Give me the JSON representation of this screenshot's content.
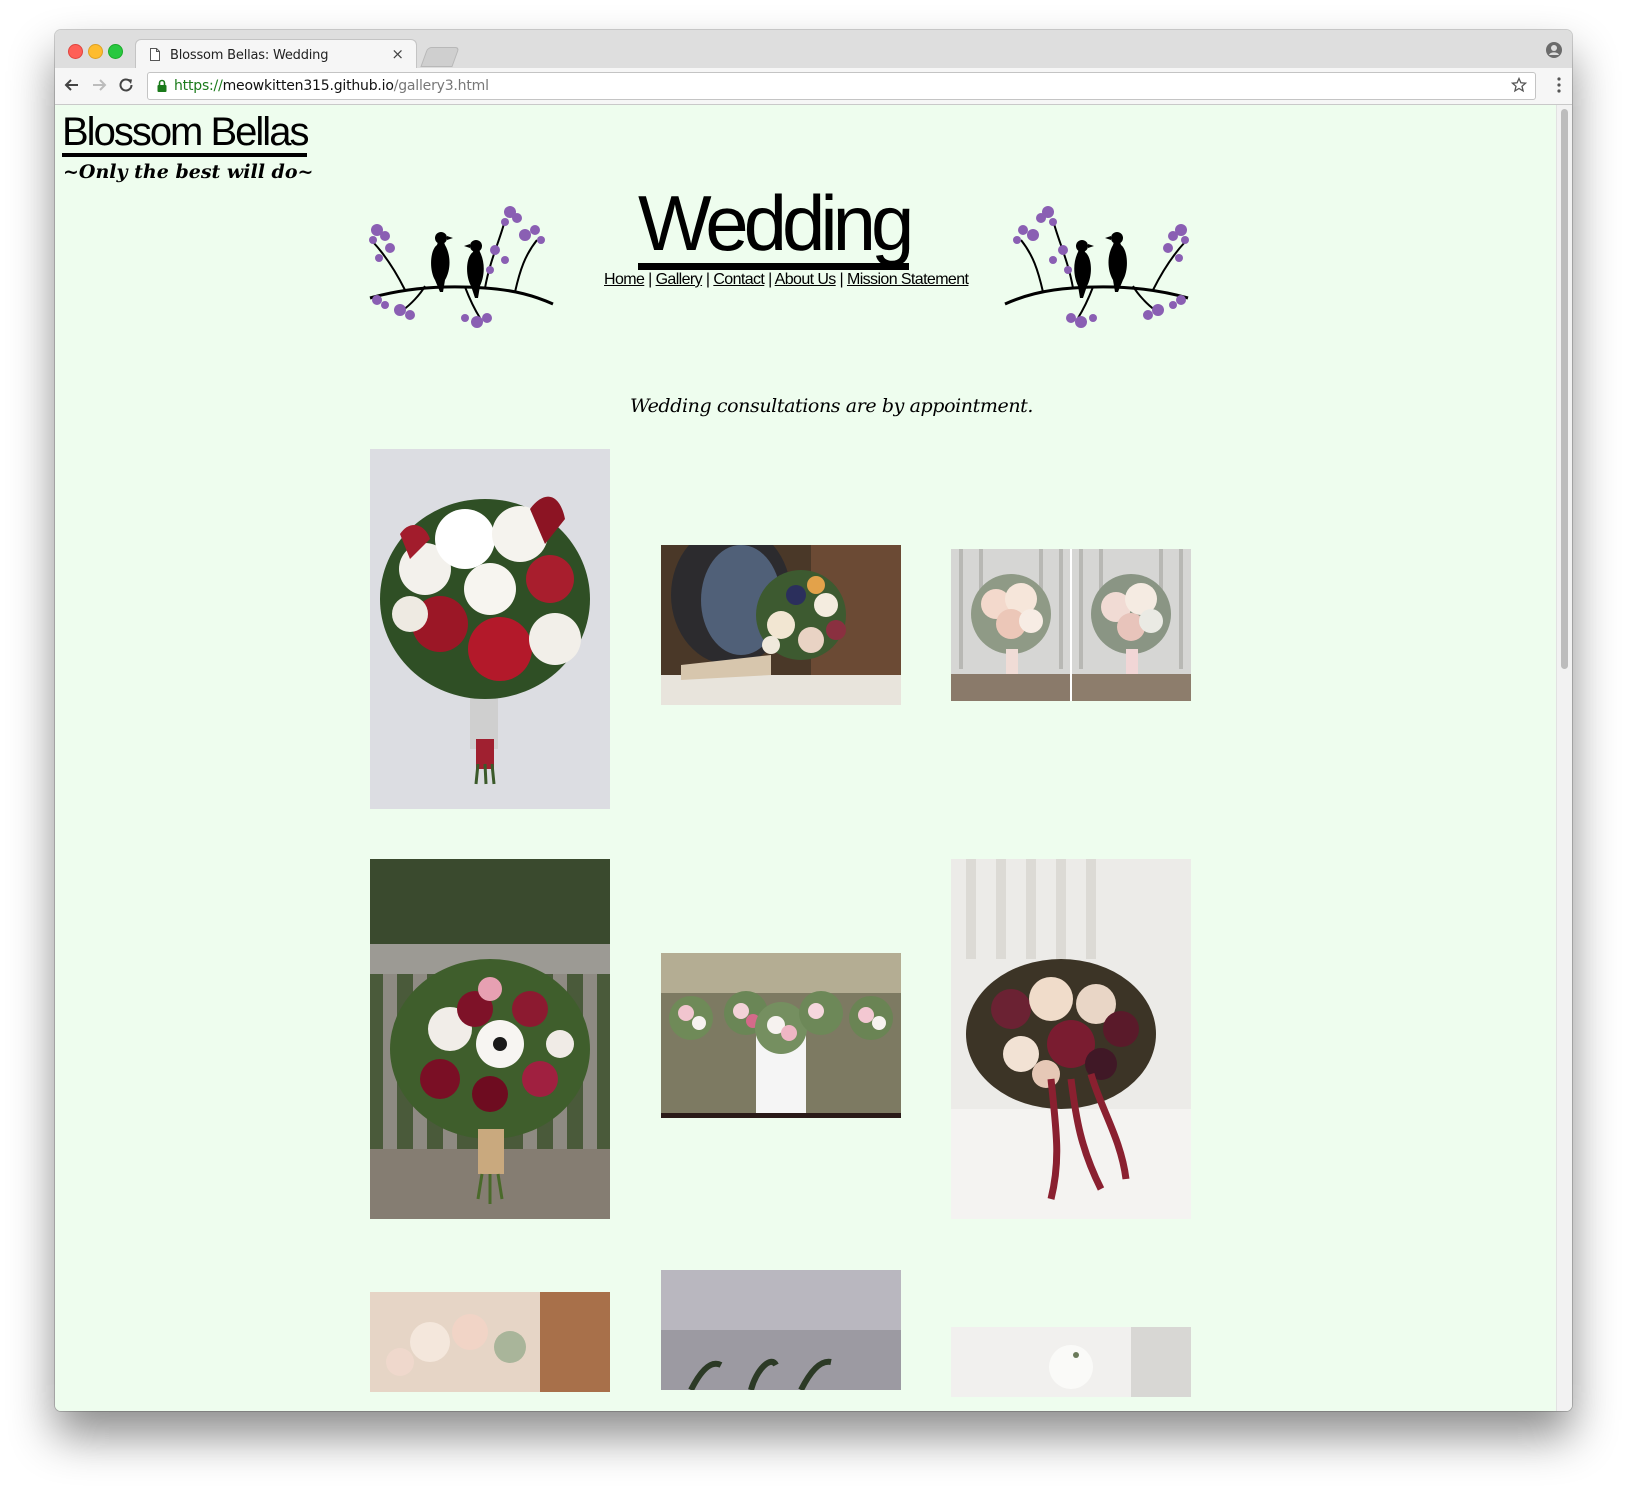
{
  "browser": {
    "tab_title": "Blossom Bellas: Wedding",
    "tab_close": "×",
    "url_scheme": "https://",
    "url_host": "meowkitten315.github.io",
    "url_path": "/gallery3.html"
  },
  "site": {
    "logo": "Blossom Bellas",
    "tagline": "~Only the best will do~"
  },
  "page": {
    "heading": "Wedding",
    "nav": [
      {
        "label": "Home"
      },
      {
        "label": "Gallery"
      },
      {
        "label": "Contact"
      },
      {
        "label": "About Us"
      },
      {
        "label": "Mission Statement"
      }
    ],
    "nav_separator": "|",
    "intro": "Wedding consultations are by appointment."
  },
  "gallery": {
    "photos": [
      {
        "subject": "red and white calla lily bridal bouquet"
      },
      {
        "subject": "mixed bouquet on table"
      },
      {
        "subject": "two pastel bouquets on chairs"
      },
      {
        "subject": "burgundy anemone bouquet on bench"
      },
      {
        "subject": "bridesmaids holding bouquets"
      },
      {
        "subject": "dark calla and amaranthus bouquet"
      },
      {
        "subject": "pastel bouquet (partial)"
      },
      {
        "subject": "greenery bouquet (partial)"
      },
      {
        "subject": "white bouquet (partial)"
      }
    ]
  },
  "colors": {
    "page_background": "#eefdee",
    "blossom_purple": "#8a5fb3"
  }
}
